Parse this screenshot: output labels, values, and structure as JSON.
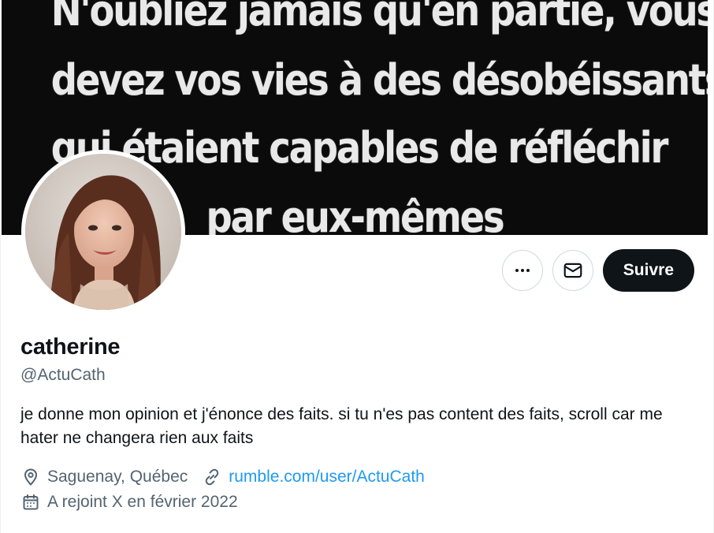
{
  "banner": {
    "lines": [
      "N'oubliez jamais qu'en partie, vous",
      "devez vos vies à des désobéissants",
      "qui étaient capables de réfléchir",
      "par eux-mêmes"
    ]
  },
  "profile": {
    "name": "catherine",
    "handle": "@ActuCath",
    "bio": "je donne mon opinion et j'énonce des faits. si tu n'es pas content des faits, scroll car me hater ne changera rien aux faits",
    "location": "Saguenay, Québec",
    "website": "rumble.com/user/ActuCath",
    "joined": "A rejoint X en février 2022"
  },
  "actions": {
    "more_icon": "more-icon",
    "message_icon": "mail-icon",
    "follow_label": "Suivre"
  },
  "colors": {
    "primary_text": "#0f1419",
    "secondary_text": "#536471",
    "link": "#1d9bf0",
    "follow_button_bg": "#0f1419",
    "banner_bg": "#0b0b0b"
  }
}
